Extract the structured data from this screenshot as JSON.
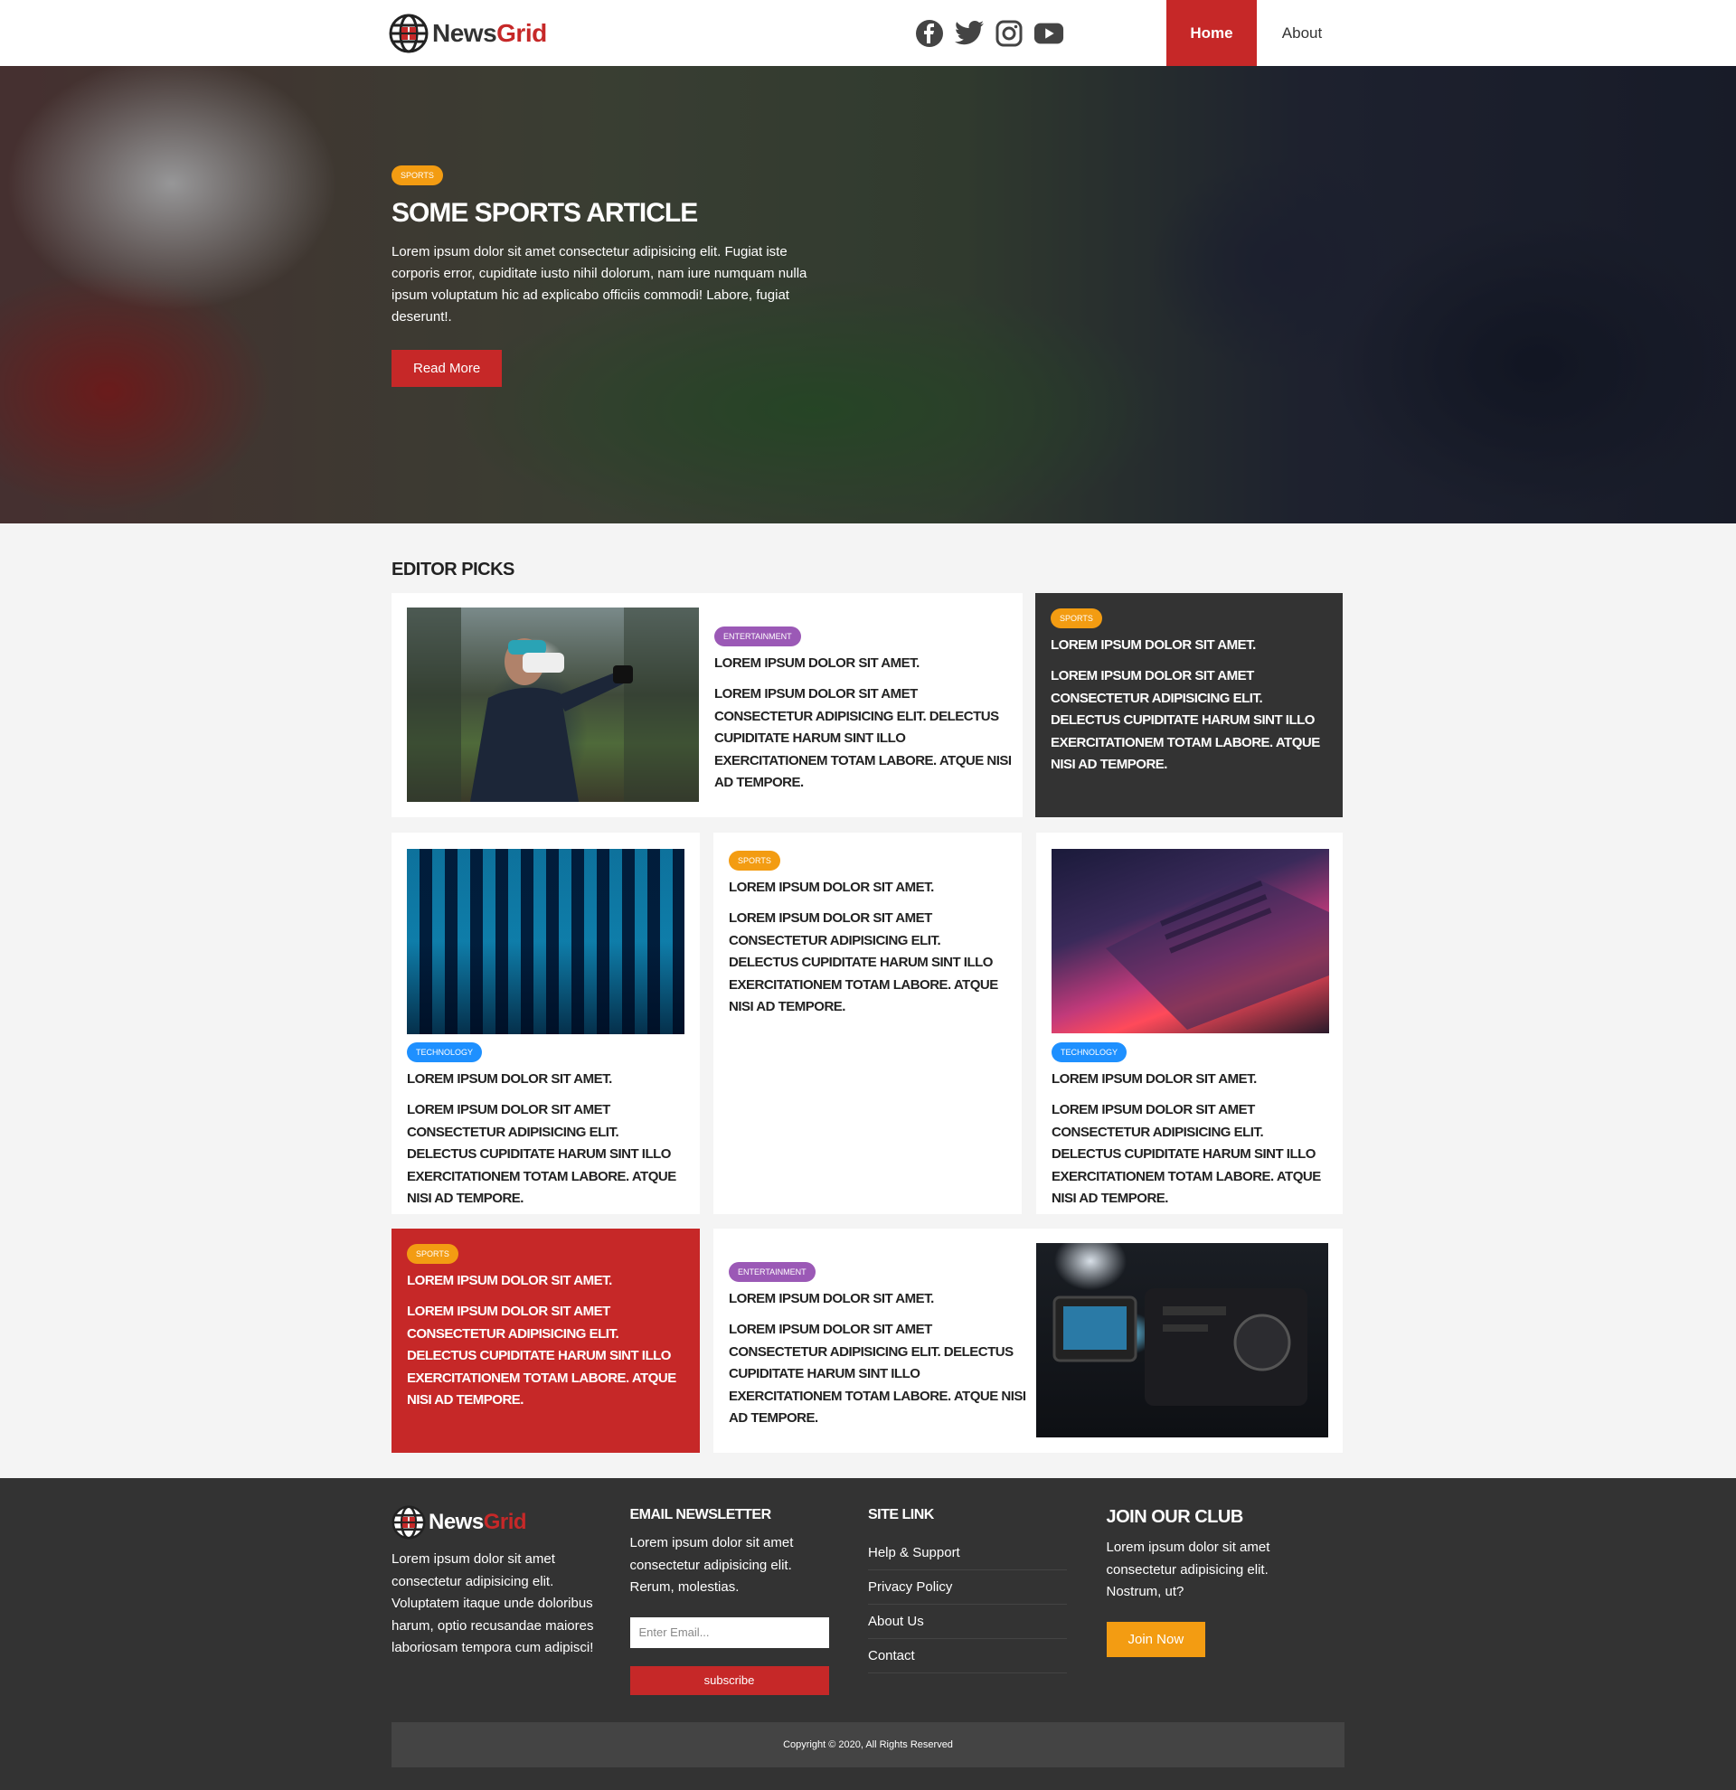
{
  "brand": {
    "name_part1": "News",
    "name_part2": "Grid"
  },
  "nav": {
    "home": "Home",
    "about": "About"
  },
  "social": [
    "facebook-icon",
    "twitter-icon",
    "instagram-icon",
    "youtube-icon"
  ],
  "colors": {
    "accent": "#c62828",
    "dark": "#333333",
    "sports": "#f39c12",
    "entertainment": "#9b59b6",
    "technology": "#1e90ff"
  },
  "hero": {
    "category": "SPORTS",
    "title": "SOME SPORTS ARTICLE",
    "text": "Lorem ipsum dolor sit amet consectetur adipisicing elit. Fugiat iste corporis error, cupiditate iusto nihil dolorum, nam iure numquam nulla ipsum voluptatum hic ad explicabo officiis commodi! Labore, fugiat deserunt!.",
    "button": "Read More"
  },
  "picks": {
    "heading": "EDITOR PICKS",
    "cards": [
      {
        "category": "ENTERTAINMENT",
        "title": "LOREM IPSUM DOLOR SIT AMET.",
        "desc": "LOREM IPSUM DOLOR SIT AMET CONSECTETUR ADIPISICING ELIT. DELECTUS CUPIDITATE HARUM SINT ILLO EXERCITATIONEM TOTAM LABORE. ATQUE NISI AD TEMPORE."
      },
      {
        "category": "SPORTS",
        "title": "LOREM IPSUM DOLOR SIT AMET.",
        "desc": "LOREM IPSUM DOLOR SIT AMET CONSECTETUR ADIPISICING ELIT. DELECTUS CUPIDITATE HARUM SINT ILLO EXERCITATIONEM TOTAM LABORE. ATQUE NISI AD TEMPORE."
      },
      {
        "category": "TECHNOLOGY",
        "title": "LOREM IPSUM DOLOR SIT AMET.",
        "desc": "LOREM IPSUM DOLOR SIT AMET CONSECTETUR ADIPISICING ELIT. DELECTUS CUPIDITATE HARUM SINT ILLO EXERCITATIONEM TOTAM LABORE. ATQUE NISI AD TEMPORE."
      },
      {
        "category": "SPORTS",
        "title": "LOREM IPSUM DOLOR SIT AMET.",
        "desc": "LOREM IPSUM DOLOR SIT AMET CONSECTETUR ADIPISICING ELIT. DELECTUS CUPIDITATE HARUM SINT ILLO EXERCITATIONEM TOTAM LABORE. ATQUE NISI AD TEMPORE."
      },
      {
        "category": "TECHNOLOGY",
        "title": "LOREM IPSUM DOLOR SIT AMET.",
        "desc": "LOREM IPSUM DOLOR SIT AMET CONSECTETUR ADIPISICING ELIT. DELECTUS CUPIDITATE HARUM SINT ILLO EXERCITATIONEM TOTAM LABORE. ATQUE NISI AD TEMPORE."
      },
      {
        "category": "SPORTS",
        "title": "LOREM IPSUM DOLOR SIT AMET.",
        "desc": "LOREM IPSUM DOLOR SIT AMET CONSECTETUR ADIPISICING ELIT. DELECTUS CUPIDITATE HARUM SINT ILLO EXERCITATIONEM TOTAM LABORE. ATQUE NISI AD TEMPORE."
      },
      {
        "category": "ENTERTAINMENT",
        "title": "LOREM IPSUM DOLOR SIT AMET.",
        "desc": "LOREM IPSUM DOLOR SIT AMET CONSECTETUR ADIPISICING ELIT. DELECTUS CUPIDITATE HARUM SINT ILLO EXERCITATIONEM TOTAM LABORE. ATQUE NISI AD TEMPORE."
      }
    ]
  },
  "footer": {
    "about_text": "Lorem ipsum dolor sit amet consectetur adipisicing elit. Voluptatem itaque unde doloribus harum, optio recusandae maiores laboriosam tempora cum adipisci!",
    "newsletter_heading": "EMAIL NEWSLETTER",
    "newsletter_text": "Lorem ipsum dolor sit amet consectetur adipisicing elit. Rerum, molestias.",
    "email_placeholder": "Enter Email...",
    "subscribe": "subscribe",
    "sitelink_heading": "SITE LINK",
    "links": [
      "Help & Support",
      "Privacy Policy",
      "About Us",
      "Contact"
    ],
    "club_heading": "JOIN OUR CLUB",
    "club_text": "Lorem ipsum dolor sit amet consectetur adipisicing elit. Nostrum, ut?",
    "join": "Join Now",
    "copyright": "Copyright © 2020, All Rights Reserved"
  }
}
